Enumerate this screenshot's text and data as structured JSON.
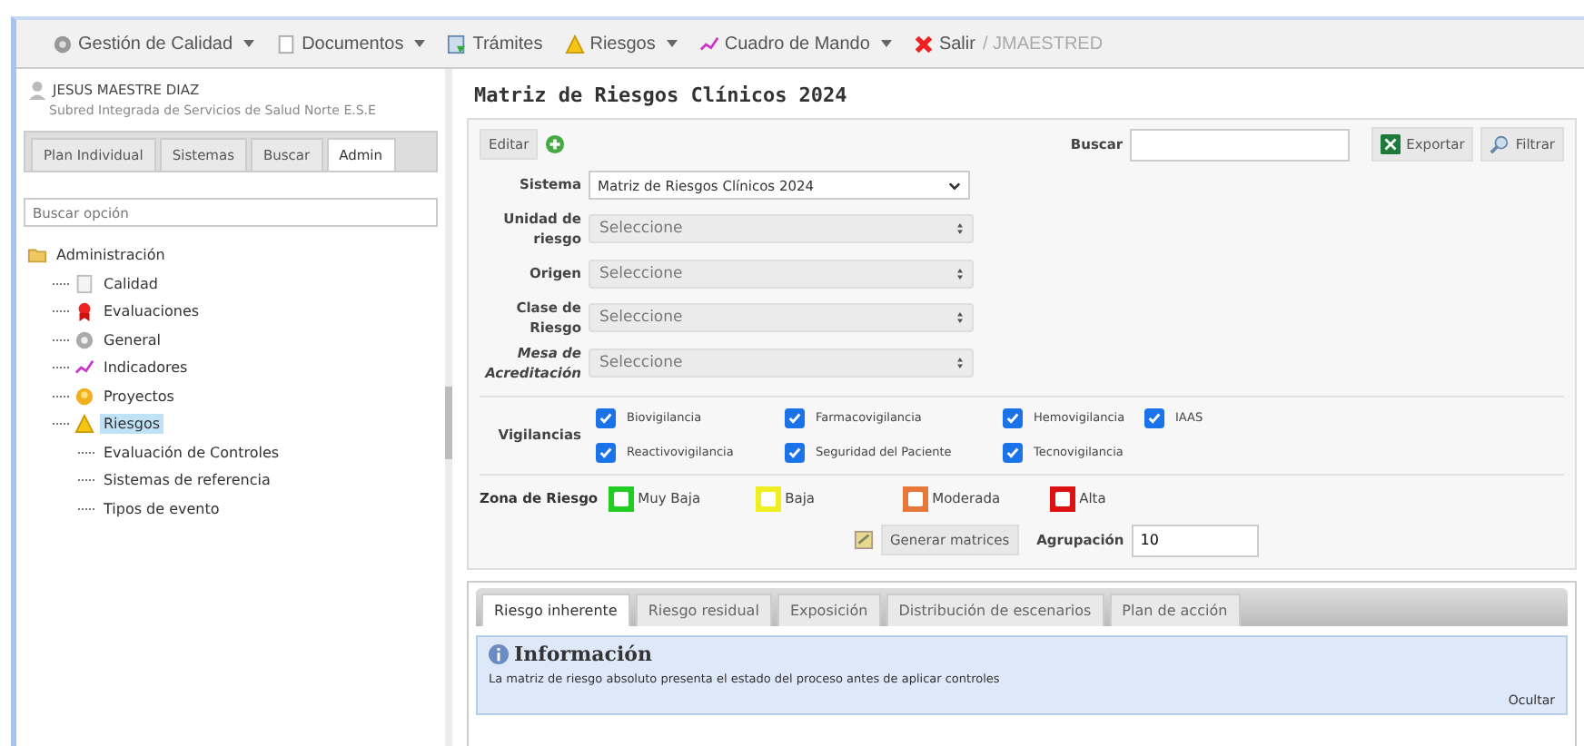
{
  "menu": [
    {
      "label": "Gestión de Calidad",
      "kind": "gear",
      "dropdown": true
    },
    {
      "label": "Documentos",
      "kind": "doc",
      "dropdown": true
    },
    {
      "label": "Trámites",
      "kind": "form",
      "dropdown": false
    },
    {
      "label": "Riesgos",
      "kind": "warning",
      "dropdown": true
    },
    {
      "label": "Cuadro de Mando",
      "kind": "chart",
      "dropdown": true
    },
    {
      "label": "Salir",
      "kind": "exit",
      "dropdown": false
    }
  ],
  "login": "/ JMAESTRED",
  "user": {
    "name": "JESUS MAESTRE DIAZ",
    "org": "Subred Integrada de Servicios de Salud Norte E.S.E"
  },
  "side_tabs": [
    {
      "label": "Plan Individual",
      "selected": false
    },
    {
      "label": "Sistemas",
      "selected": false
    },
    {
      "label": "Buscar",
      "selected": false
    },
    {
      "label": "Admin",
      "selected": true
    }
  ],
  "side_search": {
    "placeholder": "Buscar opción"
  },
  "tree": [
    {
      "label": "Administración",
      "kind": "folder",
      "selected": false,
      "children": [
        {
          "label": "Calidad",
          "kind": "doc",
          "selected": false
        },
        {
          "label": "Evaluaciones",
          "kind": "ribbon",
          "selected": false
        },
        {
          "label": "General",
          "kind": "gear",
          "selected": false
        },
        {
          "label": "Indicadores",
          "kind": "chart",
          "selected": false
        },
        {
          "label": "Proyectos",
          "kind": "badge",
          "selected": false
        },
        {
          "label": "Riesgos",
          "kind": "warning",
          "selected": true,
          "children": [
            {
              "label": "Evaluación de Controles",
              "selected": false
            },
            {
              "label": "Sistemas de referencia",
              "selected": false
            },
            {
              "label": "Tipos de evento",
              "selected": false
            }
          ]
        }
      ]
    }
  ],
  "page_title": "Matriz de Riesgos Clínicos 2024",
  "toolbar": {
    "edit": "Editar",
    "search_label": "Buscar",
    "export": "Exportar",
    "filter": "Filtrar"
  },
  "fields": [
    {
      "label": "Sistema",
      "kind": "select",
      "value": "Matriz de Riesgos Clínicos 2024"
    },
    {
      "label": "Unidad de riesgo",
      "kind": "combo",
      "placeholder": "Seleccione"
    },
    {
      "label": "Origen",
      "kind": "combo",
      "placeholder": "Seleccione"
    },
    {
      "label": "Clase de Riesgo",
      "kind": "combo",
      "placeholder": "Seleccione"
    },
    {
      "label": "Mesa de Acreditación",
      "kind": "combo",
      "placeholder": "Seleccione"
    }
  ],
  "vigilancias": {
    "label": "Vigilancias",
    "items": [
      {
        "label": "Biovigilancia",
        "checked": true
      },
      {
        "label": "Farmacovigilancia",
        "checked": true
      },
      {
        "label": "Hemovigilancia",
        "checked": true
      },
      {
        "label": "IAAS",
        "checked": true
      },
      {
        "label": "Reactivovigilancia",
        "checked": true
      },
      {
        "label": "Seguridad del Paciente",
        "checked": true
      },
      {
        "label": "Tecnovigilancia",
        "checked": true
      }
    ]
  },
  "zones": {
    "label": "Zona de Riesgo",
    "items": [
      {
        "label": "Muy Baja",
        "color": "#22cc22",
        "checked": false
      },
      {
        "label": "Baja",
        "color": "#eeee22",
        "checked": false
      },
      {
        "label": "Moderada",
        "color": "#e8783a",
        "checked": false
      },
      {
        "label": "Alta",
        "color": "#dd1111",
        "checked": false
      }
    ]
  },
  "generate": "Generar matrices",
  "grouping": {
    "label": "Agrupación",
    "value": "10"
  },
  "tabs": [
    {
      "label": "Riesgo inherente",
      "selected": true
    },
    {
      "label": "Riesgo residual",
      "selected": false
    },
    {
      "label": "Exposición",
      "selected": false
    },
    {
      "label": "Distribución de escenarios",
      "selected": false
    },
    {
      "label": "Plan de acción",
      "selected": false
    }
  ],
  "info": {
    "title": "Información",
    "text": "La matriz de riesgo absoluto presenta el estado del proceso antes de aplicar controles",
    "hide": "Ocultar"
  }
}
